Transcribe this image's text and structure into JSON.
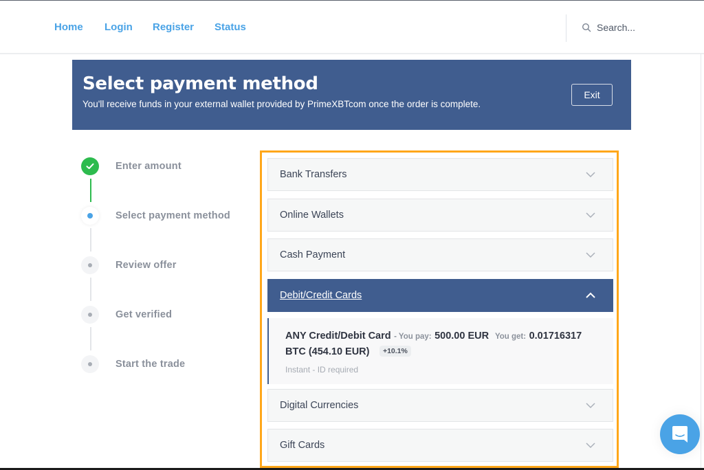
{
  "nav": {
    "links": [
      {
        "label": "Home"
      },
      {
        "label": "Login"
      },
      {
        "label": "Register"
      },
      {
        "label": "Status"
      }
    ],
    "search_placeholder": "Search...",
    "search_icon": "search-icon"
  },
  "banner": {
    "title": "Select payment method",
    "subtitle": "You'll receive funds in your external wallet provided by PrimeXBTcom once the order is complete.",
    "exit_label": "Exit",
    "color": "#405d8f"
  },
  "steps": [
    {
      "label": "Enter amount",
      "state": "done"
    },
    {
      "label": "Select payment method",
      "state": "current"
    },
    {
      "label": "Review offer",
      "state": "todo"
    },
    {
      "label": "Get verified",
      "state": "todo"
    },
    {
      "label": "Start the trade",
      "state": "todo"
    }
  ],
  "payment_methods": {
    "highlight_color": "#ffa71a",
    "categories": [
      {
        "label": "Bank Transfers",
        "expanded": false
      },
      {
        "label": "Online Wallets",
        "expanded": false
      },
      {
        "label": "Cash Payment",
        "expanded": false
      },
      {
        "label": "Debit/Credit Cards",
        "expanded": true
      },
      {
        "label": "Digital Currencies",
        "expanded": false
      },
      {
        "label": "Gift Cards",
        "expanded": false
      }
    ],
    "offer": {
      "name": "ANY Credit/Debit Card",
      "pay_label": "- You pay:",
      "pay_value": "500.00 EUR",
      "get_label": "You get:",
      "get_value": "0.01716317",
      "get_value_cont": "BTC (454.10 EUR)",
      "premium": "+10.1%",
      "meta": "Instant - ID required"
    }
  },
  "chat": {
    "icon": "chat-icon",
    "color": "#4aa3e6"
  }
}
